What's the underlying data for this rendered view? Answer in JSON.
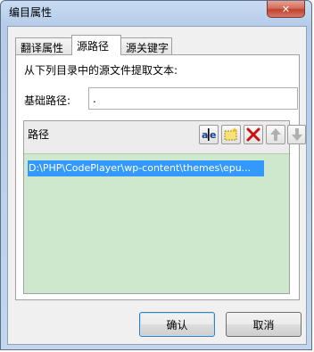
{
  "window": {
    "title": "编目属性",
    "close_glyph": "✕"
  },
  "tabs": [
    {
      "label": "翻译属性",
      "active": false
    },
    {
      "label": "源路径",
      "active": true
    },
    {
      "label": "源关键字",
      "active": false
    }
  ],
  "source_path": {
    "instruction": "从下列目录中的源文件提取文本:",
    "base_path_label": "基础路径:",
    "base_path_value": ".",
    "path_list_label": "路径",
    "toolbar_icons": [
      "rename-icon",
      "new-folder-icon",
      "delete-icon",
      "move-up-icon",
      "move-down-icon"
    ],
    "paths": [
      "D:\\PHP\\CodePlayer\\wp-content\\themes\\epu..."
    ]
  },
  "buttons": {
    "ok": "确认",
    "cancel": "取消"
  },
  "colors": {
    "list_background": "#cde8cd",
    "selection": "#3399ff",
    "close_button": "#c7513c",
    "delete_icon": "#cc1111"
  }
}
